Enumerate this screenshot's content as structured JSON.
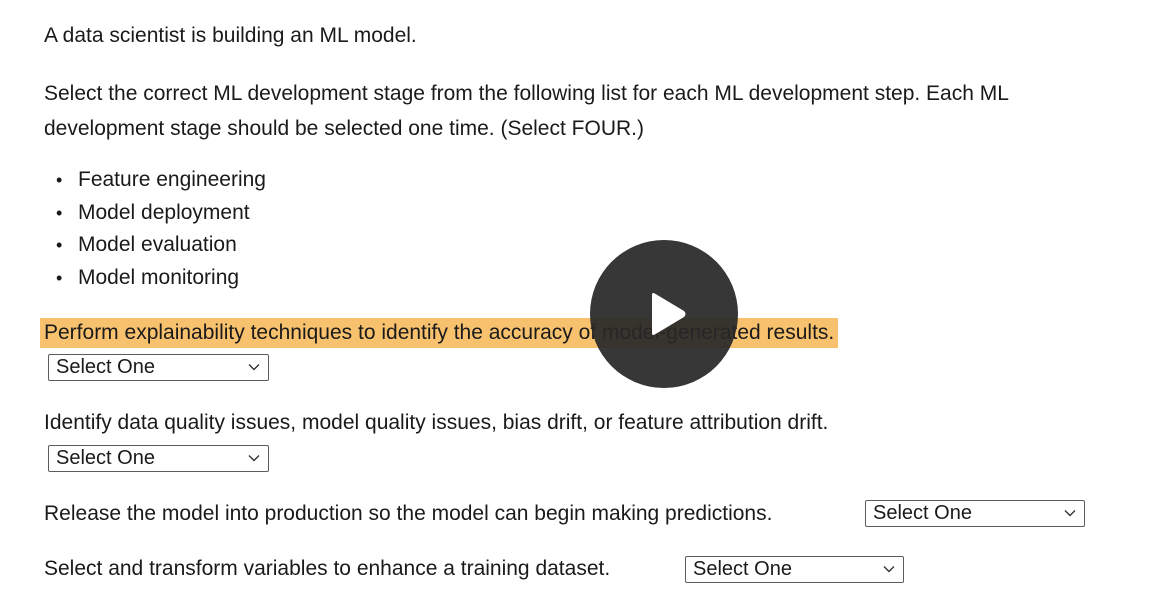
{
  "intro": "A data scientist is building an ML model.",
  "instructions": "Select the correct ML development stage from the following list for each ML development step. Each ML development stage should be selected one time. (Select FOUR.)",
  "options": [
    "Feature engineering",
    "Model deployment",
    "Model evaluation",
    "Model monitoring"
  ],
  "questions": [
    {
      "text": "Perform explainability techniques to identify the accuracy of model-generated results.",
      "selected": "Select One"
    },
    {
      "text": "Identify data quality issues, model quality issues, bias drift, or feature attribution drift.",
      "selected": "Select One"
    },
    {
      "text": "Release the model into production so the model can begin making predictions.",
      "selected": "Select One"
    },
    {
      "text": "Select and transform variables to enhance a training dataset.",
      "selected": "Select One"
    }
  ],
  "colors": {
    "highlight": "#f8c16e",
    "play_overlay": "#282828"
  },
  "icons": {
    "play": "play-icon",
    "dropdown": "chevron-down-icon",
    "bullet": "bullet-icon"
  }
}
